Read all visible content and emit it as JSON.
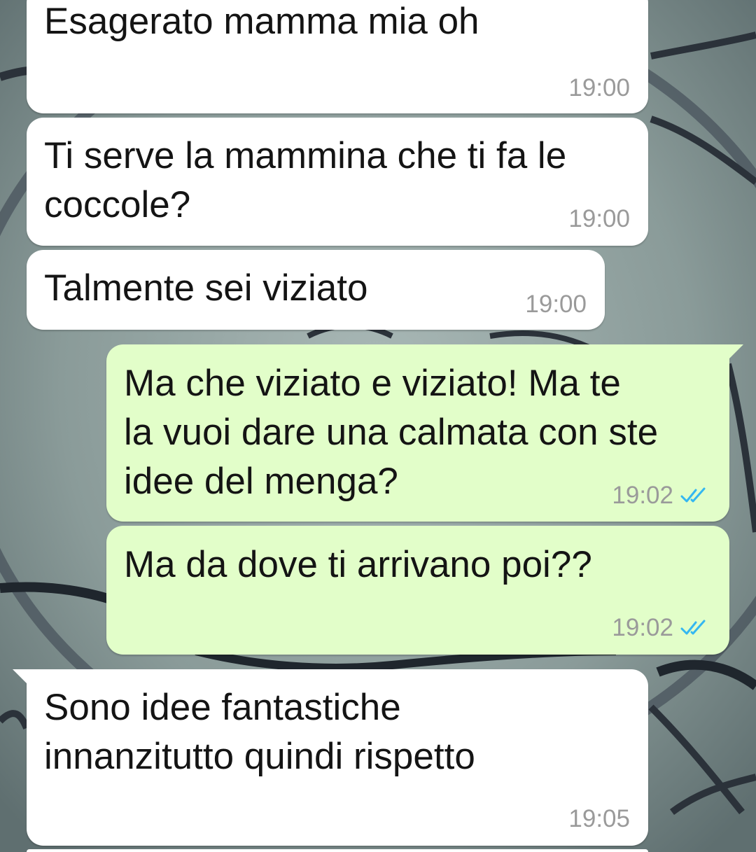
{
  "messages": [
    {
      "direction": "incoming",
      "lines": [
        "Esagerato mamma mia oh"
      ],
      "time": "19:00"
    },
    {
      "direction": "incoming",
      "lines": [
        "Ti serve la mammina che ti fa le",
        "coccole?"
      ],
      "time": "19:00"
    },
    {
      "direction": "incoming",
      "lines": [
        "Talmente sei viziato"
      ],
      "time": "19:00"
    },
    {
      "direction": "outgoing",
      "lines": [
        "Ma che viziato e viziato! Ma te",
        "la vuoi dare una calmata con ste",
        "idee del menga?"
      ],
      "time": "19:02",
      "status": "read"
    },
    {
      "direction": "outgoing",
      "lines": [
        "Ma da dove ti arrivano poi??"
      ],
      "time": "19:02",
      "status": "read"
    },
    {
      "direction": "incoming",
      "lines": [
        "Sono idee fantastiche",
        "innanzitutto quindi rispetto"
      ],
      "time": "19:05"
    }
  ],
  "colors": {
    "incoming_bubble": "#ffffff",
    "outgoing_bubble": "#e2fec9",
    "timestamp": "#9a9a9a",
    "read_ticks": "#34b7f1",
    "wallpaper": "#7e8e8c"
  },
  "icons": {
    "read_status": "double-check-icon"
  }
}
